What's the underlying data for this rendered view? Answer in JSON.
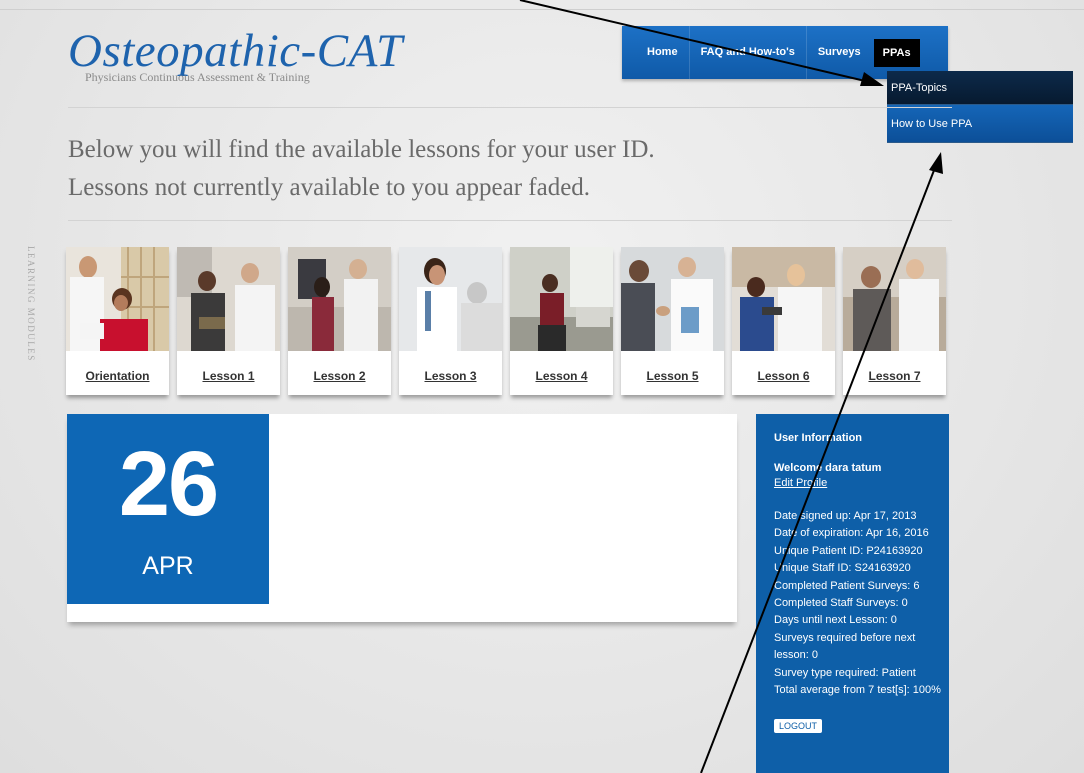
{
  "logo": {
    "title": "Osteopathic-CAT",
    "subtitle": "Physicians Continuous Assessment & Training"
  },
  "nav": {
    "items": [
      "Home",
      "FAQ and How-to's",
      "Surveys"
    ],
    "active": "PPAs",
    "dropdown": [
      "PPA-Topics",
      "How to Use PPA"
    ]
  },
  "intro": {
    "line1": "Below you will find the available lessons for your user ID.",
    "line2": "Lessons not currently available to you appear faded."
  },
  "sidebar_label": "LEARNING MODULES",
  "lessons": [
    {
      "label": "Orientation"
    },
    {
      "label": "Lesson 1"
    },
    {
      "label": "Lesson 2"
    },
    {
      "label": "Lesson 3"
    },
    {
      "label": "Lesson 4"
    },
    {
      "label": "Lesson 5"
    },
    {
      "label": "Lesson 6"
    },
    {
      "label": "Lesson 7"
    }
  ],
  "date": {
    "day": "26",
    "month": "APR"
  },
  "user_info": {
    "title": "User Information",
    "welcome": "Welcome dara tatum",
    "edit_profile": "Edit Profile",
    "stats": [
      "Date signed up: Apr 17, 2013",
      "Date of expiration: Apr 16, 2016",
      "Unique Patient ID: P24163920",
      "Unique Staff ID: S24163920",
      "Completed Patient Surveys: 6",
      "Completed Staff Surveys: 0",
      "Days until next Lesson: 0",
      "Surveys required before next lesson: 0",
      "Survey type required: Patient",
      "Total average from 7 test[s]: 100%"
    ],
    "logout": "LOGOUT"
  },
  "colors": {
    "brand_blue": "#1e63ad",
    "panel_blue": "#0e5fa8",
    "date_blue": "#0e67b5",
    "nav_active": "#000000"
  }
}
